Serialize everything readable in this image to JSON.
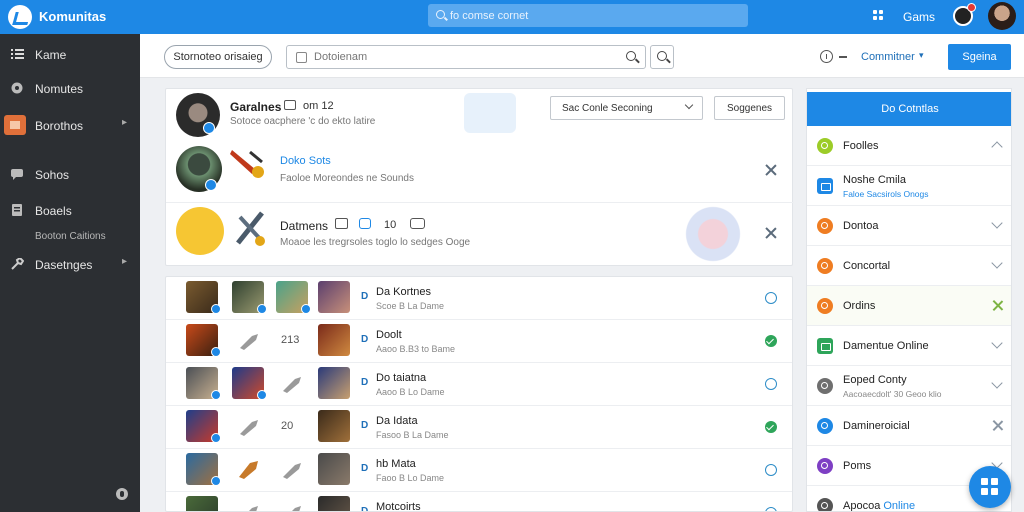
{
  "topbar": {
    "brand": "Komunitas",
    "search_placeholder": "fo comse cornet",
    "games_label": "Gams",
    "accent": "#1e88e5"
  },
  "sidebar": {
    "items": [
      {
        "label": "Kame",
        "icon": "list-icon"
      },
      {
        "label": "Nomutes",
        "icon": "globe-icon"
      },
      {
        "label": "Borothos",
        "icon": "folder-icon",
        "active": true
      },
      {
        "label": "Sohos",
        "icon": "chat-icon"
      },
      {
        "label": "Boaels",
        "icon": "document-icon"
      },
      {
        "label": "Dasetnges",
        "icon": "wrench-icon"
      }
    ],
    "sub_label": "Booton Caitions"
  },
  "subheader": {
    "pill_button": "Stornoteo orisaieg",
    "search_placeholder": "Dotoienam",
    "context_label": "Commitner",
    "signup_button": "Sgeina"
  },
  "top_card": {
    "header": {
      "title": "Garalnes",
      "count": "om 12",
      "subtitle": "Sotoce oacphere 'c do ekto latire"
    },
    "dropdown": "Sac Conle Seconing",
    "suggest_button": "Soggenes",
    "rows": [
      {
        "title": "Doko Sots",
        "subtitle": "Faoloe  Moreondes  ne Sounds"
      },
      {
        "title": "Datmens",
        "count": "10",
        "subtitle": "Moaoe les tregrsoles toglo lo sedges Ooge"
      }
    ]
  },
  "list": [
    {
      "name": "Da Kortnes",
      "meta": "Scoe  B  La Dame",
      "num": "",
      "action": "heart"
    },
    {
      "name": "Doolt",
      "meta": "Aaoo  B.B3 to Bame",
      "num": "213",
      "action": "check"
    },
    {
      "name": "Do taiatna",
      "meta": "Aaoo  B  Lo Dame",
      "num": "",
      "action": "heart"
    },
    {
      "name": "Da Idata",
      "meta": "Fasoo  B  La Dame",
      "num": "20",
      "action": "check"
    },
    {
      "name": "hb Mata",
      "meta": "Faoo  B  Lo Dame",
      "num": "",
      "action": "heart"
    },
    {
      "name": "Motcoirts",
      "meta": "",
      "num": "",
      "action": "heart"
    }
  ],
  "right_panel": {
    "header": "Do Cotntlas",
    "items": [
      {
        "label": "Foolles",
        "color": "#9ccc28",
        "control": "chevron-up"
      },
      {
        "label": "Noshe Cmila",
        "sub": "Faloe Sacsirols Onogs",
        "color": "#1e88e5",
        "control": "none",
        "square": true
      },
      {
        "label": "Dontoa",
        "color": "#ef7d22",
        "control": "chevron-down"
      },
      {
        "label": "Concortal",
        "color": "#ef7d22",
        "control": "chevron-down"
      },
      {
        "label": "Ordins",
        "color": "#ef7d22",
        "control": "x",
        "highlight": true
      },
      {
        "label": "Damentue Online",
        "color": "#2ea55a",
        "control": "chevron-down",
        "square": true
      },
      {
        "label": "Eoped Conty",
        "sub": "Aacoaecdolt' 30 Geoo klio",
        "color": "#6f6f6f",
        "control": "chevron-down"
      },
      {
        "label": "Damineroicial",
        "color": "#1e88e5",
        "control": "x"
      },
      {
        "label": "Poms",
        "color": "#7e3fc4",
        "control": "chevron-down"
      },
      {
        "label": "Apocoa",
        "label_accent": "Online",
        "color": "#555",
        "control": "none"
      }
    ]
  }
}
